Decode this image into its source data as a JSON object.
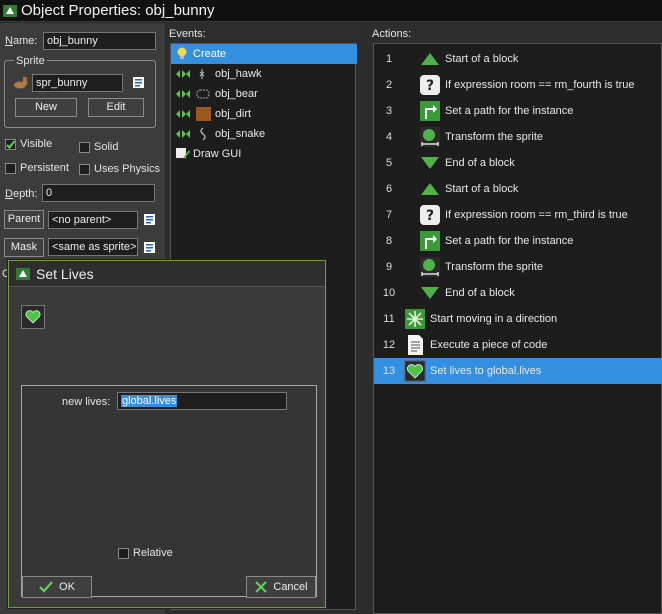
{
  "window": {
    "title": "Object Properties: obj_bunny"
  },
  "left": {
    "name_label": "Name:",
    "name_value": "obj_bunny",
    "sprite_group": "Sprite",
    "sprite_value": "spr_bunny",
    "new_button": "New",
    "edit_button": "Edit",
    "visible_label": "Visible",
    "visible_checked": true,
    "solid_label": "Solid",
    "solid_checked": false,
    "persistent_label": "Persistent",
    "persistent_checked": false,
    "physics_label": "Uses Physics",
    "physics_checked": false,
    "depth_label": "Depth:",
    "depth_value": "0",
    "parent_button": "Parent",
    "parent_value": "<no parent>",
    "mask_button": "Mask",
    "mask_value": "<same as sprite>",
    "truncated_label": "C"
  },
  "events": {
    "header": "Events:",
    "items": [
      {
        "label": "Create",
        "icon": "lightbulb-icon",
        "selected": true
      },
      {
        "label": "obj_hawk",
        "icon": "collision-icon",
        "selected": false
      },
      {
        "label": "obj_bear",
        "icon": "collision-icon",
        "selected": false
      },
      {
        "label": "obj_dirt",
        "icon": "collision-icon",
        "selected": false
      },
      {
        "label": "obj_snake",
        "icon": "collision-icon",
        "selected": false
      },
      {
        "label": "Draw GUI",
        "icon": "draw-gui-icon",
        "selected": false
      }
    ]
  },
  "actions": {
    "header": "Actions:",
    "items": [
      {
        "num": "1",
        "label": "Start of a block",
        "icon": "triangle-up-icon",
        "indent": 1
      },
      {
        "num": "2",
        "label": "If expression room == rm_fourth is true",
        "icon": "question-icon",
        "indent": 1
      },
      {
        "num": "3",
        "label": "Set a path for the instance",
        "icon": "path-icon",
        "indent": 1
      },
      {
        "num": "4",
        "label": "Transform the sprite",
        "icon": "transform-icon",
        "indent": 1
      },
      {
        "num": "5",
        "label": "End of a block",
        "icon": "triangle-down-icon",
        "indent": 1
      },
      {
        "num": "6",
        "label": "Start of a block",
        "icon": "triangle-up-icon",
        "indent": 1
      },
      {
        "num": "7",
        "label": "If expression room == rm_third is true",
        "icon": "question-icon",
        "indent": 1
      },
      {
        "num": "8",
        "label": "Set a path for the instance",
        "icon": "path-icon",
        "indent": 1
      },
      {
        "num": "9",
        "label": "Transform the sprite",
        "icon": "transform-icon",
        "indent": 1
      },
      {
        "num": "10",
        "label": "End of a block",
        "icon": "triangle-down-icon",
        "indent": 1
      },
      {
        "num": "11",
        "label": "Start moving in a direction",
        "icon": "move-arrows-icon",
        "indent": 0
      },
      {
        "num": "12",
        "label": "Execute a piece of code",
        "icon": "code-page-icon",
        "indent": 0
      },
      {
        "num": "13",
        "label": "Set lives to global.lives",
        "icon": "heart-icon",
        "indent": 0,
        "selected": true
      }
    ]
  },
  "dialog": {
    "title": "Set Lives",
    "new_lives_label": "new lives:",
    "new_lives_value": "global.lives",
    "relative_label": "Relative",
    "relative_checked": false,
    "ok_button": "OK",
    "cancel_button": "Cancel"
  },
  "colors": {
    "accent": "#3390e0",
    "green": "#4fb34a",
    "dialog_border": "#6aa040"
  }
}
